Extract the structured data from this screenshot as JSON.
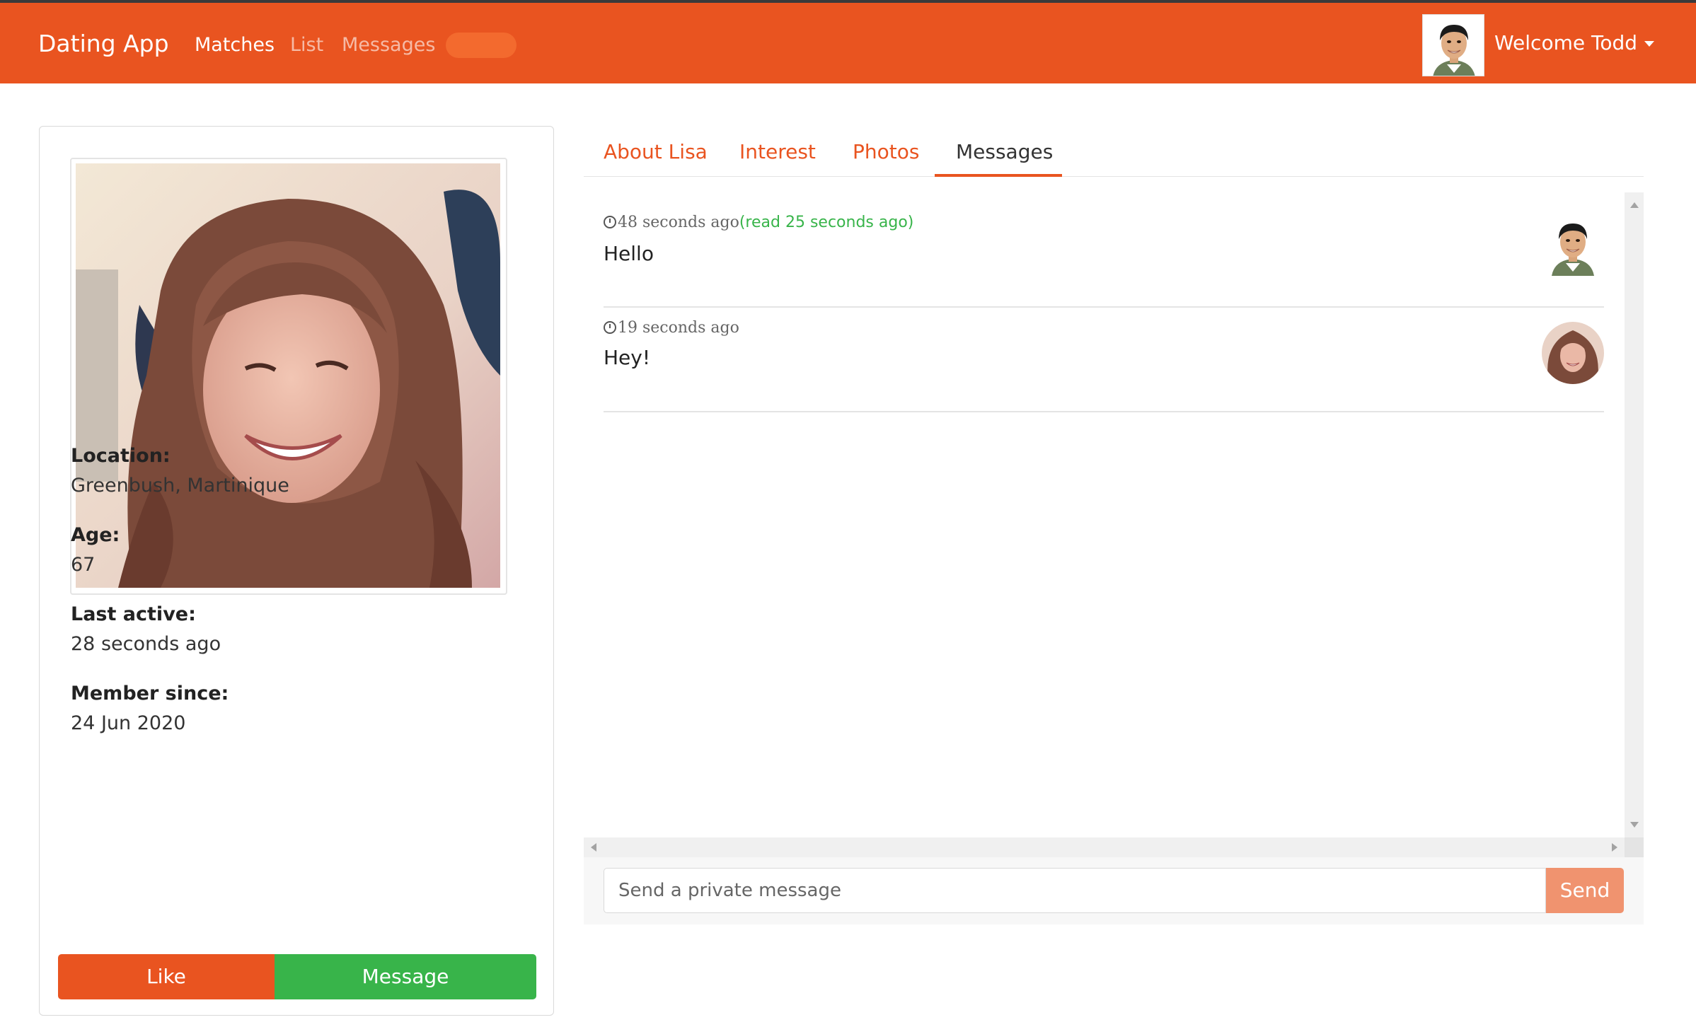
{
  "navbar": {
    "brand": "Dating App",
    "links": [
      "Matches",
      "List",
      "Messages"
    ],
    "welcome": "Welcome Todd",
    "color": "#e95420"
  },
  "profile": {
    "location_label": "Location:",
    "location_value": "Greenbush, Martinique",
    "age_label": "Age:",
    "age_value": "67",
    "last_active_label": "Last active:",
    "last_active_value": "28 seconds ago",
    "member_since_label": "Member since:",
    "member_since_value": "24 Jun 2020",
    "like_label": "Like",
    "message_label": "Message"
  },
  "tabs": [
    "About Lisa",
    "Interest",
    "Photos",
    "Messages"
  ],
  "active_tab": "Messages",
  "messages": [
    {
      "time": "48 seconds ago",
      "read": "(read 25 seconds ago)",
      "text": "Hello",
      "sender": "Todd"
    },
    {
      "time": "19 seconds ago",
      "read": "",
      "text": "Hey!",
      "sender": "Lisa"
    }
  ],
  "composer": {
    "placeholder": "Send a private message",
    "send_label": "Send"
  },
  "colors": {
    "primary": "#e95420",
    "success": "#38b44a",
    "send_disabled": "#f0936f"
  }
}
